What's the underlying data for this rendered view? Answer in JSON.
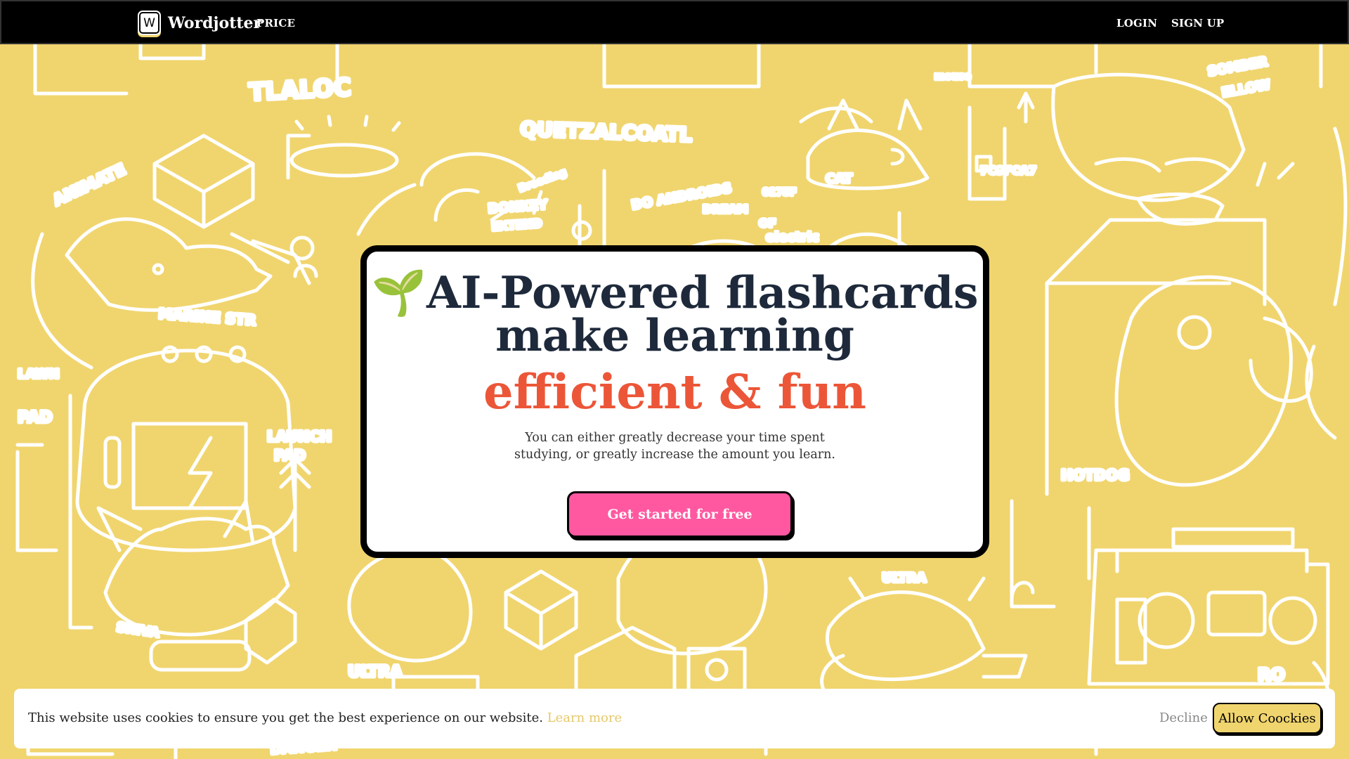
{
  "nav": {
    "brand_logo_letter": "W",
    "brand_name": "Wordjotter",
    "price_label": "PRICE",
    "login_label": "LOGIN",
    "signup_label": "SIGN UP"
  },
  "background": {
    "doodle_labels": [
      "TLALOC",
      "QUETZALCOATL",
      "ANIMATE",
      "MARINE STR",
      "LAWN PAD",
      "LAUNCH PAD",
      "CAT",
      "7C9FCA7",
      "DONKEY EXTEND",
      "DO ANDROIDS DREAM OF electric",
      "SOMBER ELLOW",
      "HOTDOG",
      "SHIVA",
      "ULTRA",
      "ULTRA",
      "RO",
      "DANGER",
      "Breeding",
      "mouse",
      "0175F"
    ]
  },
  "hero": {
    "sprout_icon": "🌱",
    "headline_line1": "AI-Powered flashcards",
    "headline_line2": "make learning",
    "headline_accent": "efficient & fun",
    "subtext": "You can either greatly decrease your time spent studying, or greatly increase the amount you learn.",
    "cta_label": "Get started for free"
  },
  "cookie": {
    "message": "This website uses cookies to ensure you get the best experience on our website.",
    "learn_more": "Learn more",
    "decline_label": "Decline",
    "allow_label": "Allow Coockies"
  },
  "colors": {
    "background": "#f0d56e",
    "nav": "#000000",
    "headline": "#1e2a3b",
    "accent": "#ec5638",
    "cta": "#ff58a0"
  }
}
